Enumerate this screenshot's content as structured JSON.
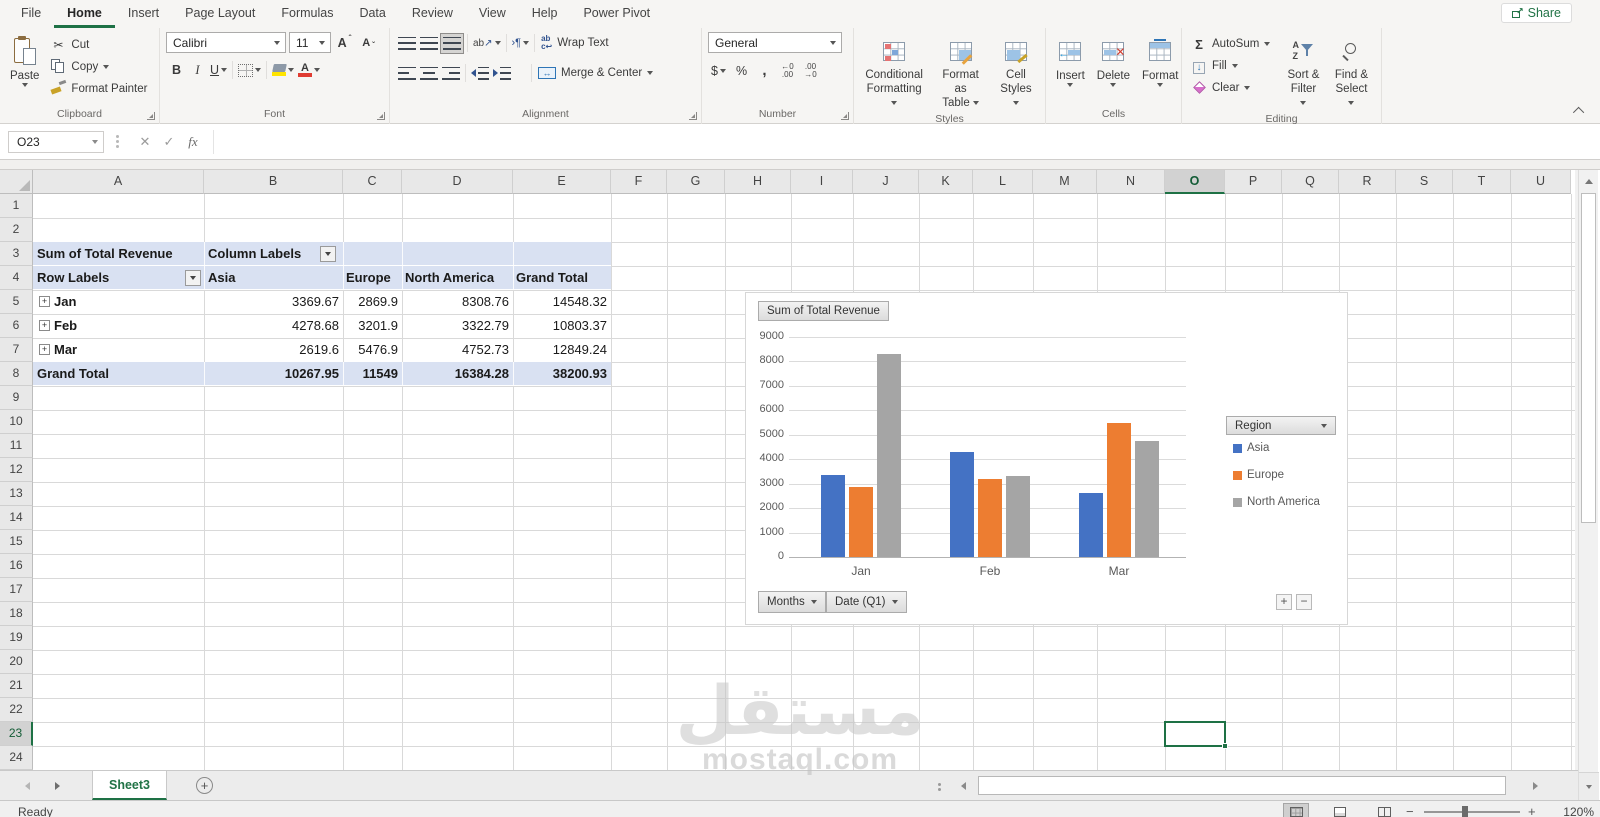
{
  "app": {
    "share_label": "Share"
  },
  "ribbon_tabs": [
    {
      "label": "File",
      "active": false
    },
    {
      "label": "Home",
      "active": true
    },
    {
      "label": "Insert",
      "active": false
    },
    {
      "label": "Page Layout",
      "active": false
    },
    {
      "label": "Formulas",
      "active": false
    },
    {
      "label": "Data",
      "active": false
    },
    {
      "label": "Review",
      "active": false
    },
    {
      "label": "View",
      "active": false
    },
    {
      "label": "Help",
      "active": false
    },
    {
      "label": "Power Pivot",
      "active": false
    }
  ],
  "ribbon": {
    "clipboard": {
      "label": "Clipboard",
      "paste": "Paste",
      "cut": "Cut",
      "copy": "Copy",
      "format_painter": "Format Painter"
    },
    "font": {
      "label": "Font",
      "family": "Calibri",
      "size": "11",
      "bold": "B",
      "italic": "I",
      "underline": "U"
    },
    "alignment": {
      "label": "Alignment",
      "wrap_text": "Wrap Text",
      "merge_center": "Merge & Center"
    },
    "number": {
      "label": "Number",
      "format": "General",
      "currency": "$",
      "percent": "%",
      "comma": ","
    },
    "styles": {
      "label": "Styles",
      "conditional_1": "Conditional",
      "conditional_2": "Formatting",
      "format_table_1": "Format as",
      "format_table_2": "Table",
      "cell_styles_1": "Cell",
      "cell_styles_2": "Styles"
    },
    "cells": {
      "label": "Cells",
      "insert": "Insert",
      "delete": "Delete",
      "format": "Format"
    },
    "editing": {
      "label": "Editing",
      "autosum": "AutoSum",
      "fill": "Fill",
      "clear": "Clear",
      "sort_1": "Sort &",
      "sort_2": "Filter",
      "find_1": "Find &",
      "find_2": "Select"
    }
  },
  "formula_bar": {
    "cell_reference": "O23",
    "fx_label": "fx",
    "formula": ""
  },
  "sheet": {
    "columns": [
      "A",
      "B",
      "C",
      "D",
      "E",
      "F",
      "G",
      "H",
      "I",
      "J",
      "K",
      "L",
      "M",
      "N",
      "O",
      "P",
      "Q",
      "R",
      "S",
      "T",
      "U"
    ],
    "row_count": 24,
    "active_cell": "O23",
    "selected_column": "O",
    "selected_row": 23,
    "tab": "Sheet3",
    "pivot": {
      "value_field": "Sum of Total Revenue",
      "column_labels": "Column Labels",
      "row_labels": "Row Labels",
      "column_headers": [
        "Asia",
        "Europe",
        "North America",
        "Grand Total"
      ],
      "data_rows": [
        {
          "label": "Jan",
          "values": [
            "3369.67",
            "2869.9",
            "8308.76",
            "14548.32"
          ]
        },
        {
          "label": "Feb",
          "values": [
            "4278.68",
            "3201.9",
            "3322.79",
            "10803.37"
          ]
        },
        {
          "label": "Mar",
          "values": [
            "2619.6",
            "5476.9",
            "4752.73",
            "12849.24"
          ]
        }
      ],
      "grand_total_row": {
        "label": "Grand Total",
        "values": [
          "10267.95",
          "11549",
          "16384.28",
          "38200.93"
        ]
      }
    }
  },
  "chart_data": {
    "type": "bar",
    "title": "Sum of Total Revenue",
    "value_field_button": "Sum of Total Revenue",
    "legend_field_button": "Region",
    "axis_field_buttons": [
      "Months",
      "Date (Q1)"
    ],
    "categories": [
      "Jan",
      "Feb",
      "Mar"
    ],
    "series": [
      {
        "name": "Asia",
        "color": "#4472C4",
        "values": [
          3369.67,
          4278.68,
          2619.6
        ]
      },
      {
        "name": "Europe",
        "color": "#ED7D31",
        "values": [
          2869.9,
          3201.9,
          5476.9
        ]
      },
      {
        "name": "North America",
        "color": "#A5A5A5",
        "values": [
          8308.76,
          3322.79,
          4752.73
        ]
      }
    ],
    "ylim": [
      0,
      9000
    ],
    "ytick_step": 1000,
    "grid": true,
    "legend_position": "right"
  },
  "status": {
    "ready": "Ready",
    "zoom_level": "120%"
  },
  "watermark": {
    "arabic": "مستقل",
    "latin": "mostaql.com"
  }
}
